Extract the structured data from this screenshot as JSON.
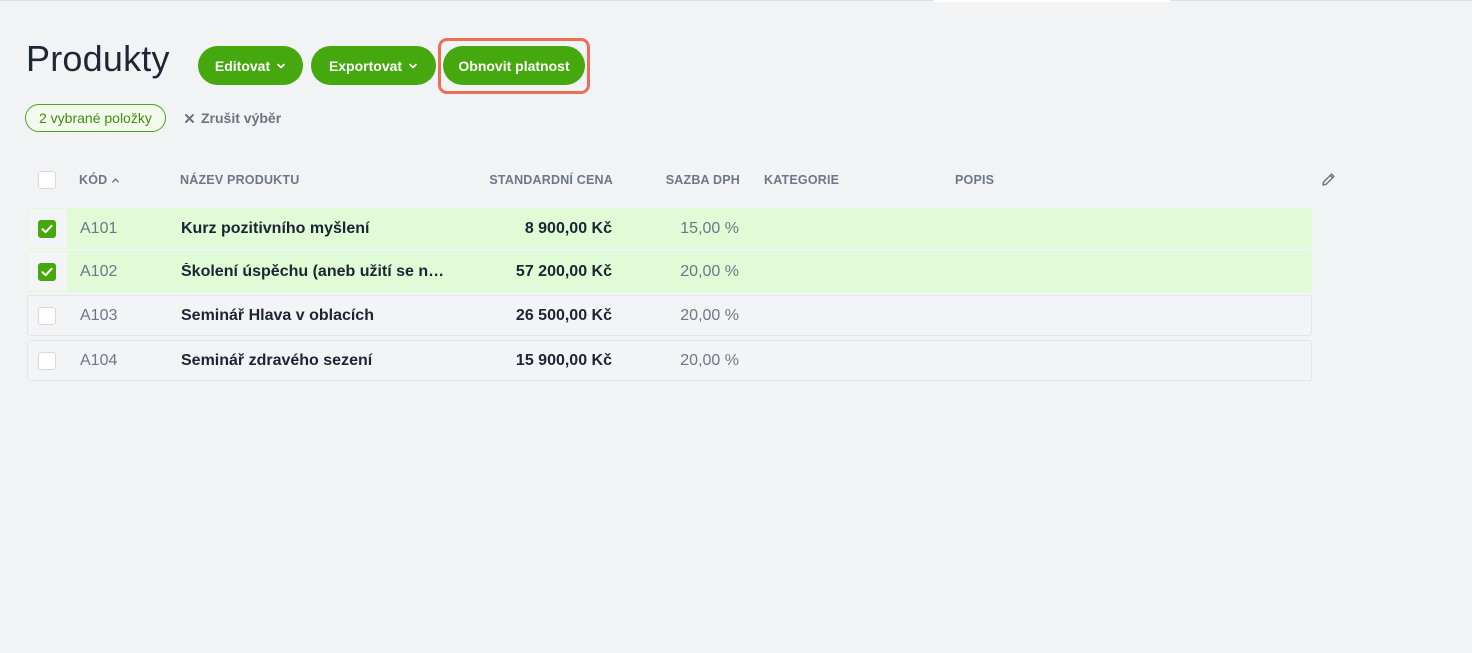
{
  "page": {
    "title": "Produkty"
  },
  "toolbar": {
    "edit_label": "Editovat",
    "export_label": "Exportovat",
    "renew_label": "Obnovit platnost"
  },
  "selection": {
    "badge_label": "2 vybrané položky",
    "clear_label": "Zrušit výběr"
  },
  "table": {
    "columns": {
      "code": "KÓD",
      "name": "NÁZEV PRODUKTU",
      "price": "STANDARDNÍ CENA",
      "vat": "SAZBA DPH",
      "category": "KATEGORIE",
      "description": "POPIS"
    },
    "sort": {
      "column": "code",
      "direction": "ascending"
    },
    "rows": [
      {
        "code": "A101",
        "name": "Kurz pozitivního myšlení",
        "price": "8 900,00 Kč",
        "vat": "15,00 %",
        "category": "",
        "description": "",
        "selected": true
      },
      {
        "code": "A102",
        "name": "Školení úspěchu (aneb užití se net…",
        "price": "57 200,00 Kč",
        "vat": "20,00 %",
        "category": "",
        "description": "",
        "selected": true
      },
      {
        "code": "A103",
        "name": "Seminář Hlava v oblacích",
        "price": "26 500,00 Kč",
        "vat": "20,00 %",
        "category": "",
        "description": "",
        "selected": false
      },
      {
        "code": "A104",
        "name": "Seminář zdravého sezení",
        "price": "15 900,00 Kč",
        "vat": "20,00 %",
        "category": "",
        "description": "",
        "selected": false
      }
    ]
  },
  "colors": {
    "accent": "#46a80f",
    "selected_row": "#e0fbd6",
    "highlight": "#ec6f55",
    "background": "#f2f3f5"
  },
  "icons": {
    "dropdown": "chevron-down-icon",
    "sort": "chevron-up-icon",
    "clear": "close-icon",
    "edit_columns": "pencil-icon",
    "check": "check-icon"
  }
}
